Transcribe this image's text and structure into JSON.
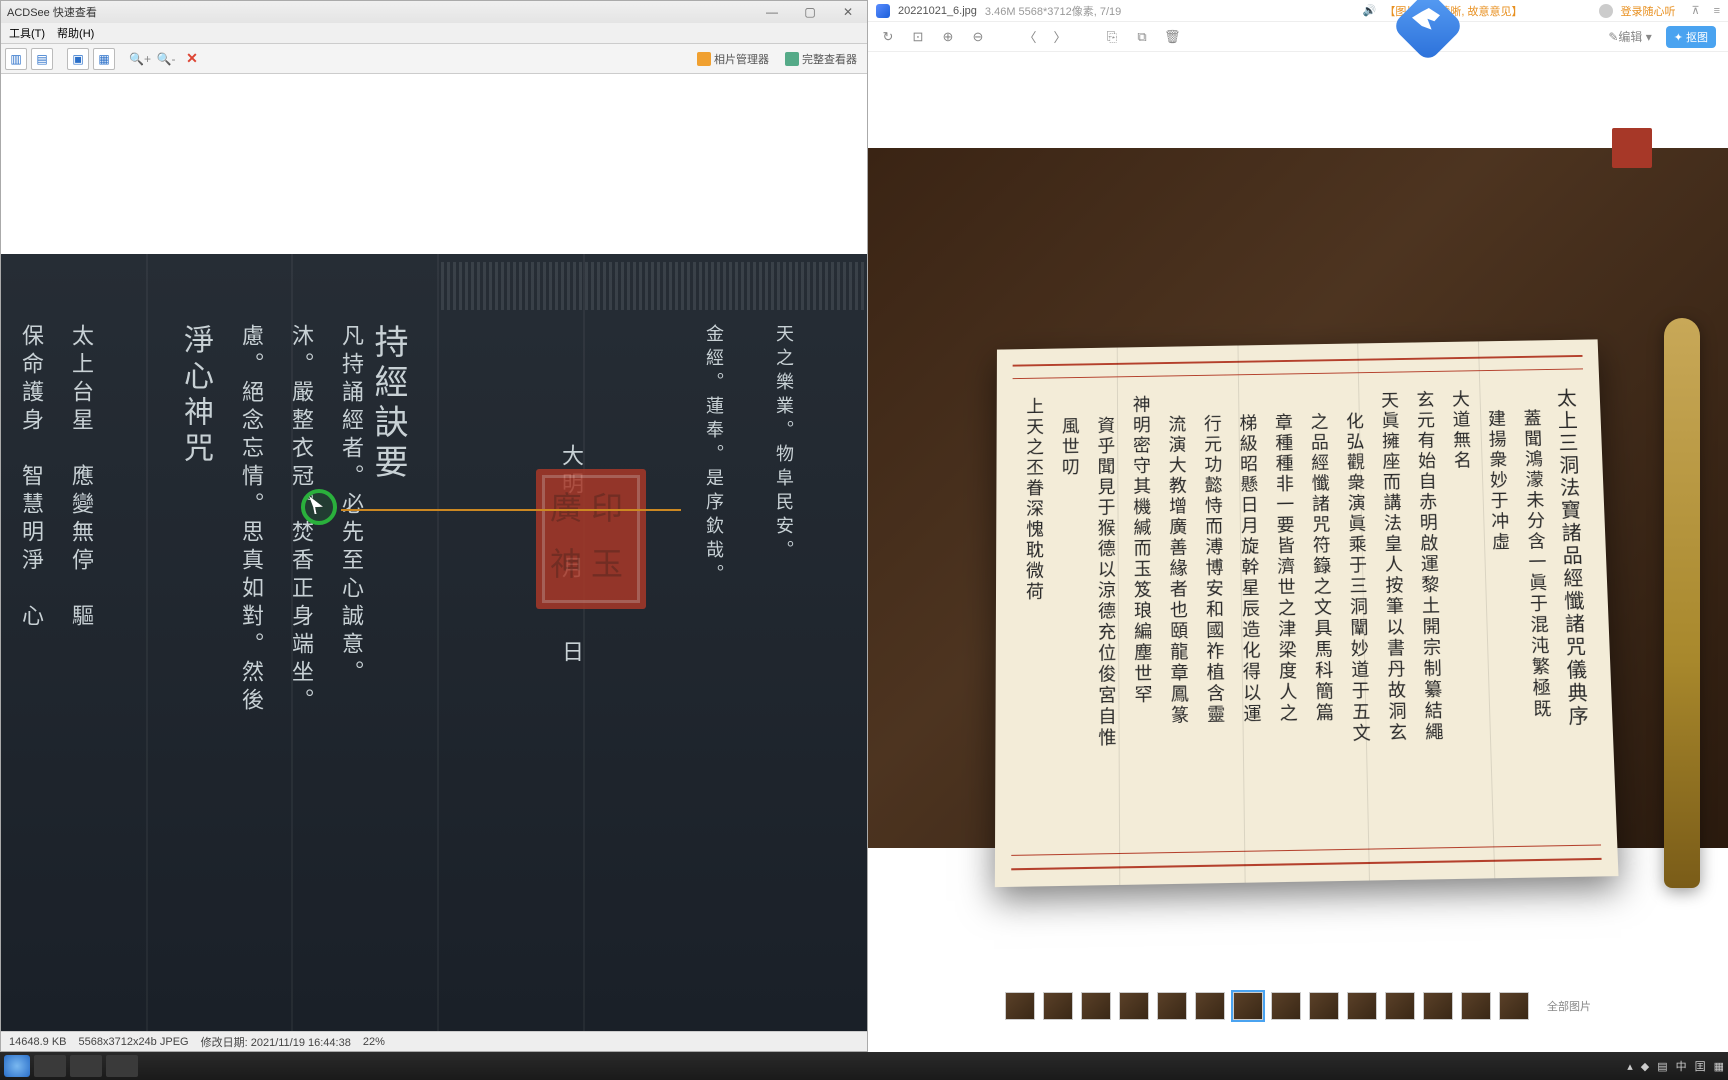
{
  "acdsee": {
    "title": "ACDSee 快速查看",
    "menu": {
      "tools": "工具(T)",
      "help": "帮助(H)"
    },
    "rbtns": {
      "mgr": "相片管理器",
      "full": "完整查看器"
    },
    "status": {
      "size": "14648.9 KB",
      "dim": "5568x3712x24b JPEG",
      "mod_label": "修改日期:",
      "mod": "2021/11/19 16:44:38",
      "zoom": "22%"
    },
    "columns": {
      "tian": "天之樂業。物阜民安。",
      "jin": "金經。蓮奉。是序欽哉。",
      "da": "大明　　月　　日",
      "chi1": "持經訣要",
      "chi2": "持經訣要",
      "fan": "凡持誦經者。必先至心誠意。",
      "mu": "沐。嚴整衣冠。焚香正身端坐。",
      "lv": "慮。絕念忘情。思真如對。然後",
      "jing": "淨心神咒",
      "tai": "太上台星　應變無停　驅",
      "bao": "保命護身　智慧明淨　心"
    }
  },
  "rv": {
    "filename": "20221021_6.jpg",
    "info": "3.46M 5568*3712像素, 7/19",
    "notice": "【图片需求清晰, 故意意见】",
    "user": "登录随心听",
    "edit": "编辑",
    "scratch": "抠图",
    "all_images": "全部图片",
    "thumb_count": 14,
    "paper_cols": [
      "太上三洞法寶諸品經懺諸咒儀典序",
      "　蓋聞鴻濛未分含一眞于混沌繁極既",
      "　建揚衆妙于冲虛",
      "大道無名",
      "玄元有始自赤明啟運黎土開宗制纂結繩",
      "天眞擁座而講法皇人按筆以書丹故洞玄",
      "　化弘觀衆演眞乘于三洞闡妙道于五文",
      "　之品經懺諸咒符籙之文具馬科簡篇",
      "　章種種非一要皆濟世之津梁度人之",
      "　梯級昭懸日月旋幹星辰造化得以運",
      "　行元功懿恃而溥博安和國祚植含靈",
      "　流演大教增廣善緣者也頤龍章鳳篆",
      "神明密守其機緘而玉笈琅編塵世罕",
      "　資乎聞見于猴德以涼德充位俊宮自惟",
      "　風世叨",
      "上天之丕眷深愧耽微荷"
    ]
  },
  "tray": {
    "ime": "中",
    "kbd": "囯"
  }
}
